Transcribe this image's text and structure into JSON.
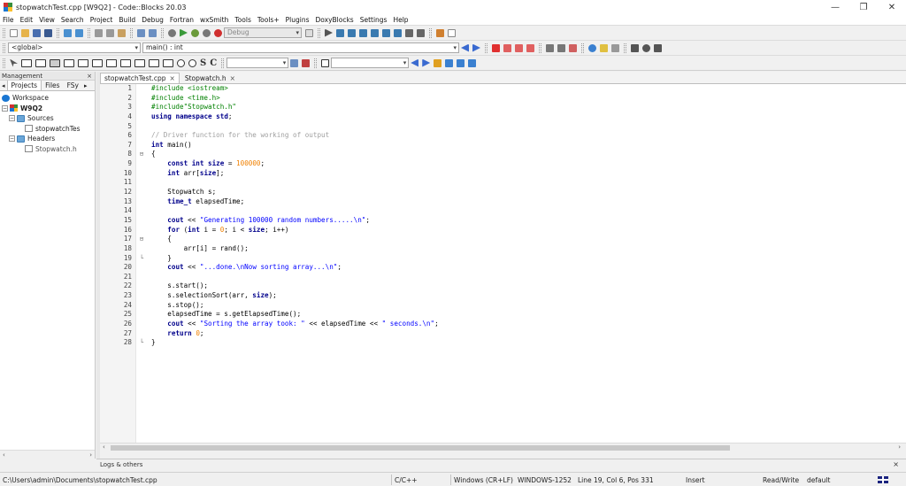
{
  "window": {
    "title": "stopwatchTest.cpp [W9Q2] - Code::Blocks 20.03",
    "minimize": "—",
    "maximize": "❐",
    "close": "✕"
  },
  "menu": [
    "File",
    "Edit",
    "View",
    "Search",
    "Project",
    "Build",
    "Debug",
    "Fortran",
    "wxSmith",
    "Tools",
    "Tools+",
    "Plugins",
    "DoxyBlocks",
    "Settings",
    "Help"
  ],
  "toolbar": {
    "build_target": "Debug",
    "scope": "<global>",
    "symbol": "main() : int",
    "format_s": "S",
    "format_c": "C"
  },
  "management": {
    "title": "Management",
    "close": "×",
    "tabs": [
      "Projects",
      "Files",
      "FSy"
    ],
    "tree": [
      {
        "label": "Workspace",
        "type": "workspace",
        "indent": 0
      },
      {
        "label": "W9Q2",
        "type": "project",
        "indent": 0
      },
      {
        "label": "Sources",
        "type": "folder",
        "indent": 1
      },
      {
        "label": "stopwatchTes",
        "type": "file",
        "indent": 2
      },
      {
        "label": "Headers",
        "type": "folder",
        "indent": 1
      },
      {
        "label": "Stopwatch.h",
        "type": "file",
        "indent": 2
      }
    ]
  },
  "editor": {
    "tabs": [
      {
        "label": "stopwatchTest.cpp",
        "close": "×",
        "active": true
      },
      {
        "label": "Stopwatch.h",
        "close": "×",
        "active": false
      }
    ],
    "lines": [
      "#include <iostream>",
      "#include <time.h>",
      "#include\"Stopwatch.h\"",
      "using namespace std;",
      "",
      "// Driver function for the working of output",
      "int main()",
      "{",
      "    const int size = 100000;",
      "    int arr[size];",
      "",
      "    Stopwatch s;",
      "    time_t elapsedTime;",
      "",
      "    cout << \"Generating 100000 random numbers.....\\n\";",
      "    for (int i = 0; i < size; i++)",
      "    {",
      "        arr[i] = rand();",
      "    }",
      "    cout << \"...done.\\nNow sorting array...\\n\";",
      "",
      "    s.start();",
      "    s.selectionSort(arr, size);",
      "    s.stop();",
      "    elapsedTime = s.getElapsedTime();",
      "    cout << \"Sorting the array took: \" << elapsedTime << \" seconds.\\n\";",
      "    return 0;",
      "}"
    ]
  },
  "logs": {
    "label": "Logs & others",
    "close": "×"
  },
  "status": {
    "path": "C:\\Users\\admin\\Documents\\stopwatchTest.cpp",
    "language": "C/C++",
    "line_endings": "Windows (CR+LF)",
    "encoding": "WINDOWS-1252",
    "position": "Line 19, Col 6, Pos 331",
    "mode": "Insert",
    "access": "Read/Write",
    "profile": "default"
  },
  "colors": {
    "keyword": "#00008b",
    "preprocessor": "#008000",
    "comment": "#a0a0a0",
    "string": "#0000ff",
    "number": "#f08000"
  }
}
